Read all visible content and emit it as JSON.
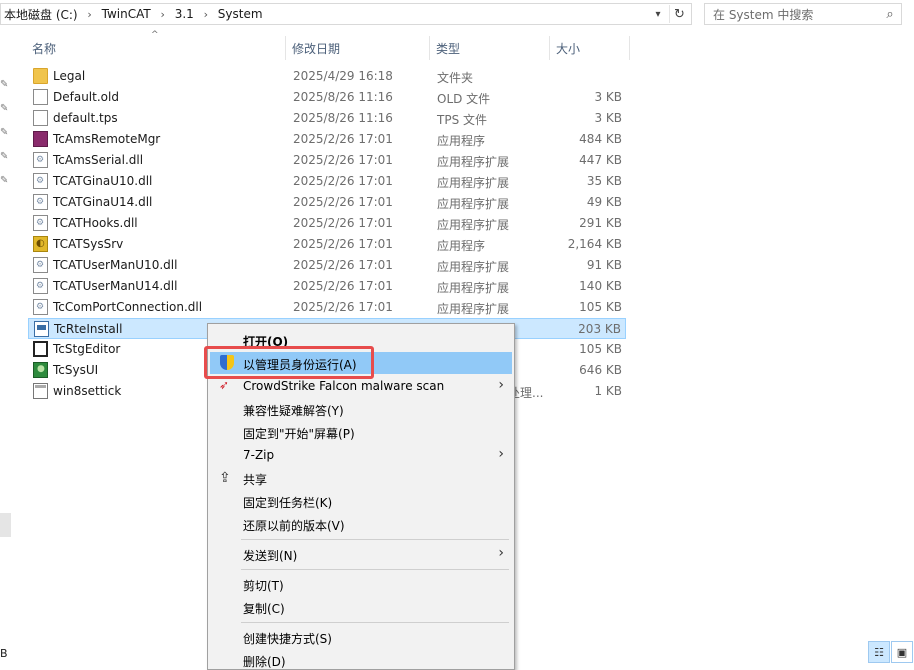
{
  "address": {
    "crumbs": [
      "本地磁盘 (C:)",
      "TwinCAT",
      "3.1",
      "System"
    ],
    "separator": "›"
  },
  "search": {
    "placeholder": "在 System 中搜索"
  },
  "columns": {
    "name": "名称",
    "date": "修改日期",
    "type": "类型",
    "size": "大小"
  },
  "files": [
    {
      "name": "Legal",
      "date": "2025/4/29 16:18",
      "type": "文件夹",
      "size": "",
      "icon": "folder-icon"
    },
    {
      "name": "Default.old",
      "date": "2025/8/26 11:16",
      "type": "OLD 文件",
      "size": "3 KB",
      "icon": "file-icon"
    },
    {
      "name": "default.tps",
      "date": "2025/8/26 11:16",
      "type": "TPS 文件",
      "size": "3 KB",
      "icon": "file-icon"
    },
    {
      "name": "TcAmsRemoteMgr",
      "date": "2025/2/26 17:01",
      "type": "应用程序",
      "size": "484 KB",
      "icon": "app-icon"
    },
    {
      "name": "TcAmsSerial.dll",
      "date": "2025/2/26 17:01",
      "type": "应用程序扩展",
      "size": "447 KB",
      "icon": "dll-icon"
    },
    {
      "name": "TCATGinaU10.dll",
      "date": "2025/2/26 17:01",
      "type": "应用程序扩展",
      "size": "35 KB",
      "icon": "dll-icon"
    },
    {
      "name": "TCATGinaU14.dll",
      "date": "2025/2/26 17:01",
      "type": "应用程序扩展",
      "size": "49 KB",
      "icon": "dll-icon"
    },
    {
      "name": "TCATHooks.dll",
      "date": "2025/2/26 17:01",
      "type": "应用程序扩展",
      "size": "291 KB",
      "icon": "dll-icon"
    },
    {
      "name": "TCATSysSrv",
      "date": "2025/2/26 17:01",
      "type": "应用程序",
      "size": "2,164 KB",
      "icon": "app-icon"
    },
    {
      "name": "TCATUserManU10.dll",
      "date": "2025/2/26 17:01",
      "type": "应用程序扩展",
      "size": "91 KB",
      "icon": "dll-icon"
    },
    {
      "name": "TCATUserManU14.dll",
      "date": "2025/2/26 17:01",
      "type": "应用程序扩展",
      "size": "140 KB",
      "icon": "dll-icon"
    },
    {
      "name": "TcComPortConnection.dll",
      "date": "2025/2/26 17:01",
      "type": "应用程序扩展",
      "size": "105 KB",
      "icon": "dll-icon"
    },
    {
      "name": "TcRteInstall",
      "date": "",
      "type": "",
      "size": "203 KB",
      "icon": "app-icon",
      "selected": true
    },
    {
      "name": "TcStgEditor",
      "date": "",
      "type": "",
      "size": "105 KB",
      "icon": "app-icon"
    },
    {
      "name": "TcSysUI",
      "date": "",
      "type": "",
      "size": "646 KB",
      "icon": "app-icon"
    },
    {
      "name": "win8settick",
      "date": "",
      "type": "处理...",
      "size": "1 KB",
      "icon": "app-icon"
    }
  ],
  "context_menu": {
    "items": [
      {
        "label": "打开(O)",
        "bold": true
      },
      {
        "label": "以管理员身份运行(A)",
        "icon": "shield-icon"
      },
      {
        "label": "CrowdStrike Falcon malware scan",
        "icon": "crowdstrike-icon",
        "submenu": true
      },
      {
        "label": "兼容性疑难解答(Y)"
      },
      {
        "label": "固定到\"开始\"屏幕(P)"
      },
      {
        "label": "7-Zip",
        "submenu": true
      },
      {
        "label": "共享",
        "icon": "share-icon"
      },
      {
        "label": "固定到任务栏(K)"
      },
      {
        "label": "还原以前的版本(V)"
      },
      {
        "label": "发送到(N)",
        "submenu": true
      },
      {
        "label": "剪切(T)"
      },
      {
        "label": "复制(C)"
      },
      {
        "label": "创建快捷方式(S)"
      },
      {
        "label": "删除(D)"
      }
    ]
  },
  "statusbar": {
    "left_text": "B"
  },
  "colors": {
    "selection": "#cce8ff",
    "highlight_border": "#e74c4c",
    "menu_bg": "#f2f2f2"
  }
}
